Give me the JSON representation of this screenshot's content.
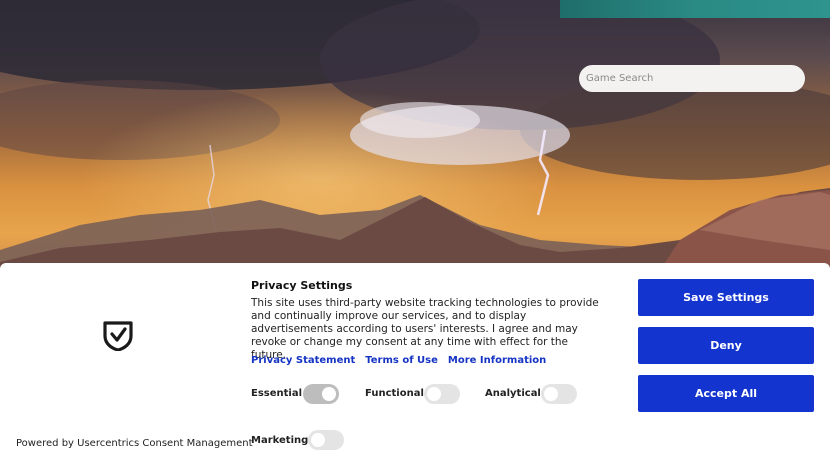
{
  "search": {
    "placeholder": "Game Search"
  },
  "consent": {
    "title": "Privacy Settings",
    "description": "This site uses third-party website tracking technologies to provide and continually improve our services, and to display advertisements according to users' interests. I agree and may revoke or change my consent at any time with effect for the future.",
    "links": {
      "privacy_statement": "Privacy Statement",
      "terms_of_use": "Terms of Use",
      "more_information": "More Information"
    },
    "categories": {
      "essential": {
        "label": "Essential",
        "enabled": true,
        "locked": true
      },
      "functional": {
        "label": "Functional",
        "enabled": false,
        "locked": false
      },
      "analytical": {
        "label": "Analytical",
        "enabled": false,
        "locked": false
      },
      "marketing": {
        "label": "Marketing",
        "enabled": false,
        "locked": false
      }
    },
    "buttons": {
      "save_settings": "Save Settings",
      "deny": "Deny",
      "accept_all": "Accept All"
    },
    "powered_by": "Powered by Usercentrics Consent Management"
  },
  "colors": {
    "accent": "#1434cf",
    "link": "#1534c4",
    "toggle_off": "#e4e4e4",
    "toggle_locked": "#bdbdbd"
  }
}
